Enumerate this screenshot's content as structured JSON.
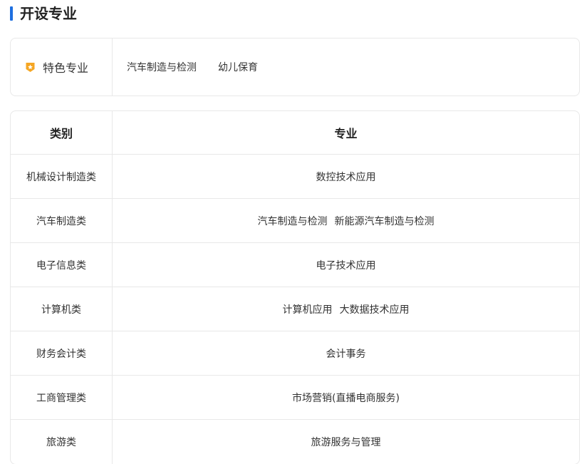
{
  "section": {
    "title": "开设专业",
    "accent_color": "#1e6fe0"
  },
  "featured": {
    "icon": "star-badge-icon",
    "icon_color": "#f5a623",
    "label": "特色专业",
    "items": [
      "汽车制造与检测",
      "幼儿保育"
    ]
  },
  "table": {
    "headers": {
      "category": "类别",
      "majors": "专业"
    },
    "rows": [
      {
        "category": "机械设计制造类",
        "majors": [
          "数控技术应用"
        ]
      },
      {
        "category": "汽车制造类",
        "majors": [
          "汽车制造与检测",
          "新能源汽车制造与检测"
        ]
      },
      {
        "category": "电子信息类",
        "majors": [
          "电子技术应用"
        ]
      },
      {
        "category": "计算机类",
        "majors": [
          "计算机应用",
          "大数据技术应用"
        ]
      },
      {
        "category": "财务会计类",
        "majors": [
          "会计事务"
        ]
      },
      {
        "category": "工商管理类",
        "majors": [
          "市场营销(直播电商服务)"
        ]
      },
      {
        "category": "旅游类",
        "majors": [
          "旅游服务与管理"
        ]
      }
    ]
  }
}
